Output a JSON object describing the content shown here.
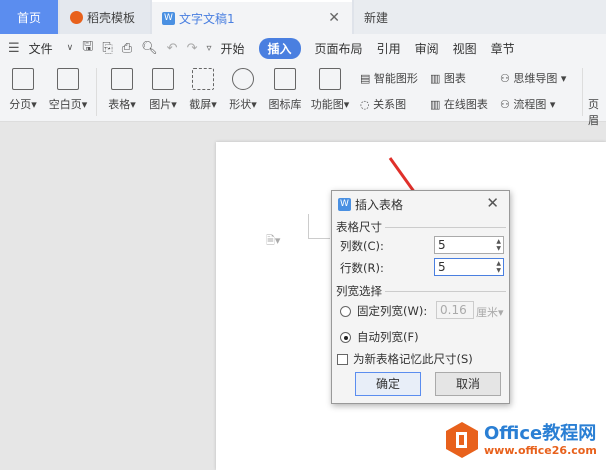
{
  "tabs": [
    {
      "label": "首页"
    },
    {
      "label": "稻壳模板"
    },
    {
      "label": "文字文稿1"
    },
    {
      "label": "新建"
    }
  ],
  "menubar": {
    "file": "文件",
    "items": [
      "开始",
      "插入",
      "页面布局",
      "引用",
      "审阅",
      "视图",
      "章节"
    ],
    "active": "插入"
  },
  "ribbon": {
    "large": [
      "分页",
      "空白页",
      "表格",
      "图片",
      "截屏",
      "形状",
      "图标库",
      "功能图"
    ],
    "small": [
      "智能图形",
      "图表",
      "思维导图",
      "关系图",
      "在线图表",
      "流程图"
    ],
    "cut": "页眉"
  },
  "dialog": {
    "title": "插入表格",
    "section_size": "表格尺寸",
    "cols_label": "列数(C):",
    "cols_value": "5",
    "rows_label": "行数(R):",
    "rows_value": "5",
    "section_width": "列宽选择",
    "fixed_label": "固定列宽(W):",
    "fixed_value": "0.16",
    "unit": "厘米",
    "auto_label": "自动列宽(F)",
    "remember_label": "为新表格记忆此尺寸(S)",
    "ok": "确定",
    "cancel": "取消"
  },
  "watermark": {
    "brand": "Office教程网",
    "url": "www.office26.com"
  },
  "colors": {
    "accent": "#4a7fe0",
    "arrow": "#e0302a",
    "logo": "#e8611c"
  }
}
